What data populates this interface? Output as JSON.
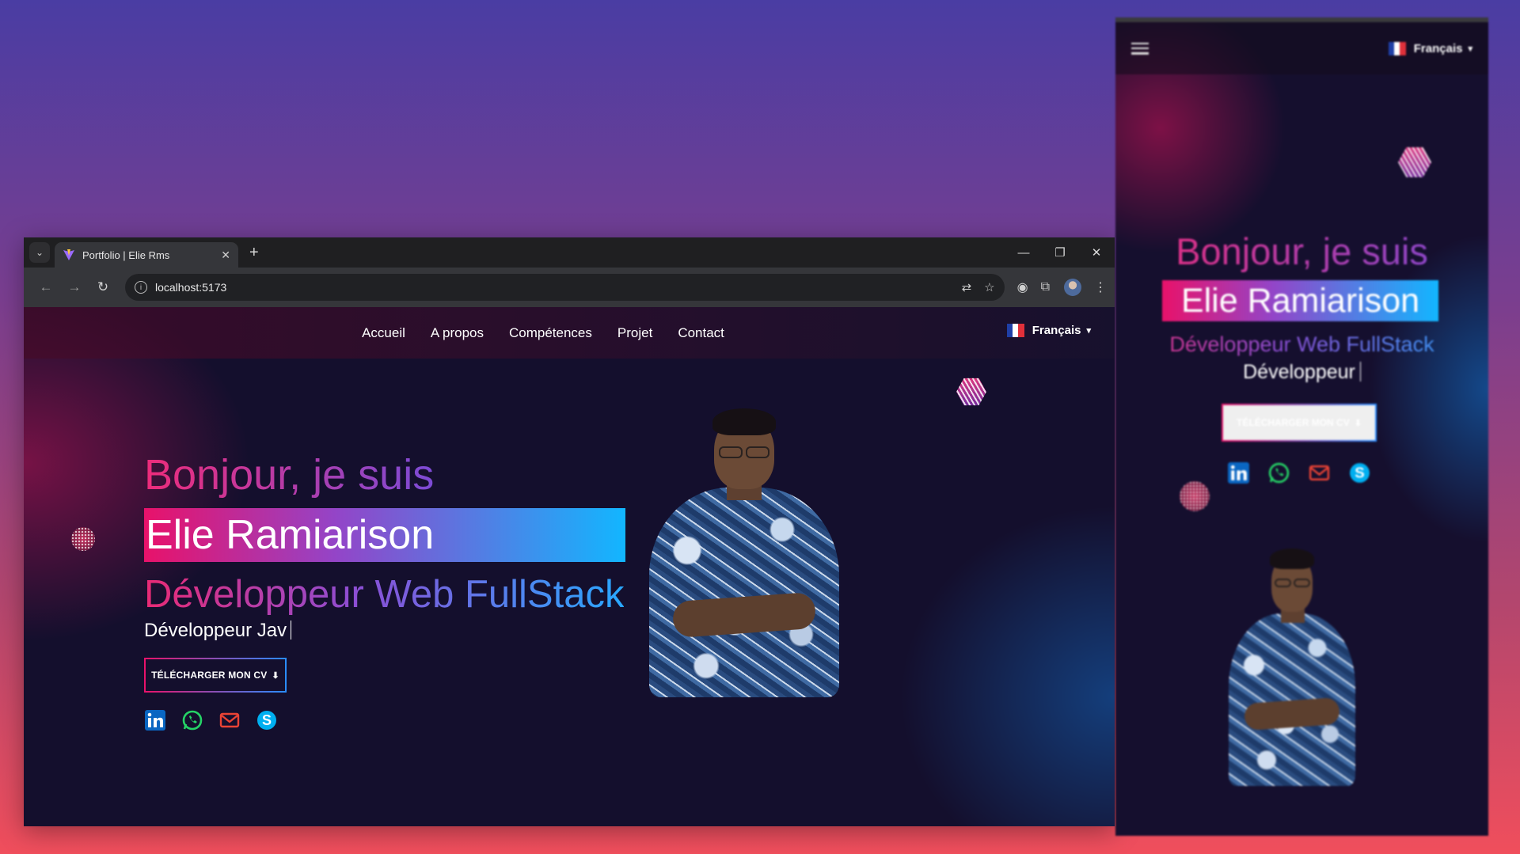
{
  "browser": {
    "tab_title": "Portfolio | Elie Rms",
    "url": "localhost:5173",
    "new_tab_symbol": "+",
    "tab_close_symbol": "✕"
  },
  "site": {
    "nav": {
      "links": [
        "Accueil",
        "A propos",
        "Compétences",
        "Projet",
        "Contact"
      ],
      "language": "Français"
    },
    "hero": {
      "greeting": "Bonjour, je suis",
      "name": "Elie Ramiarison",
      "role": "Développeur Web FullStack",
      "typing_text": "Développeur Jav",
      "cv_button": "TÉLÉCHARGER MON CV",
      "socials": [
        "linkedin-icon",
        "whatsapp-icon",
        "mail-icon",
        "skype-icon"
      ]
    }
  },
  "mobile": {
    "language": "Français",
    "greeting": "Bonjour, je suis",
    "name": "Elie Ramiarison",
    "role": "Développeur Web FullStack",
    "typing_text": "Développeur",
    "cv_button": "TÉLÉCHARGER MON CV"
  },
  "colors": {
    "brand_pink": "#e8126a",
    "brand_purple": "#9345c8",
    "brand_blue": "#12b6ff",
    "linkedin": "#0a66c2",
    "whatsapp": "#25d366",
    "mail": "#ea4335",
    "skype": "#00aff0"
  }
}
